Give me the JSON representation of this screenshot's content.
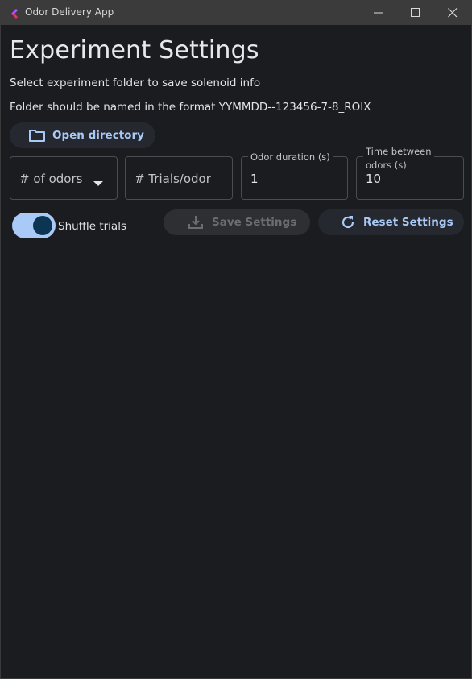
{
  "window": {
    "title": "Odor Delivery App"
  },
  "page": {
    "heading": "Experiment Settings",
    "instruction_1": "Select experiment folder to save solenoid info",
    "instruction_2": "Folder should be named in the format YYMMDD--123456-7-8_ROIX"
  },
  "buttons": {
    "open_directory": "Open directory",
    "save_settings": "Save Settings",
    "reset_settings": "Reset Settings"
  },
  "fields": {
    "num_odors": {
      "placeholder": "# of odors"
    },
    "trials_per_odor": {
      "placeholder": "# Trials/odor"
    },
    "odor_duration": {
      "label": "Odor duration (s)",
      "value": "1"
    },
    "time_between": {
      "label_line1": "Time between",
      "label_line2": "odors (s)",
      "value": "10"
    }
  },
  "shuffle": {
    "label": "Shuffle trials",
    "enabled": true
  },
  "icons": {
    "app": "app-logo-icon",
    "minimize": "minimize-icon",
    "maximize": "maximize-icon",
    "close": "close-icon",
    "folder": "folder-icon",
    "dropdown": "dropdown-arrow-icon",
    "download": "download-icon",
    "refresh": "refresh-icon"
  },
  "colors": {
    "background": "#1b1c1f",
    "titlebar": "#3b3b3b",
    "accent": "#a9c9f7",
    "toggle_knob": "#0c3553",
    "disabled_text": "#6c6d71"
  }
}
